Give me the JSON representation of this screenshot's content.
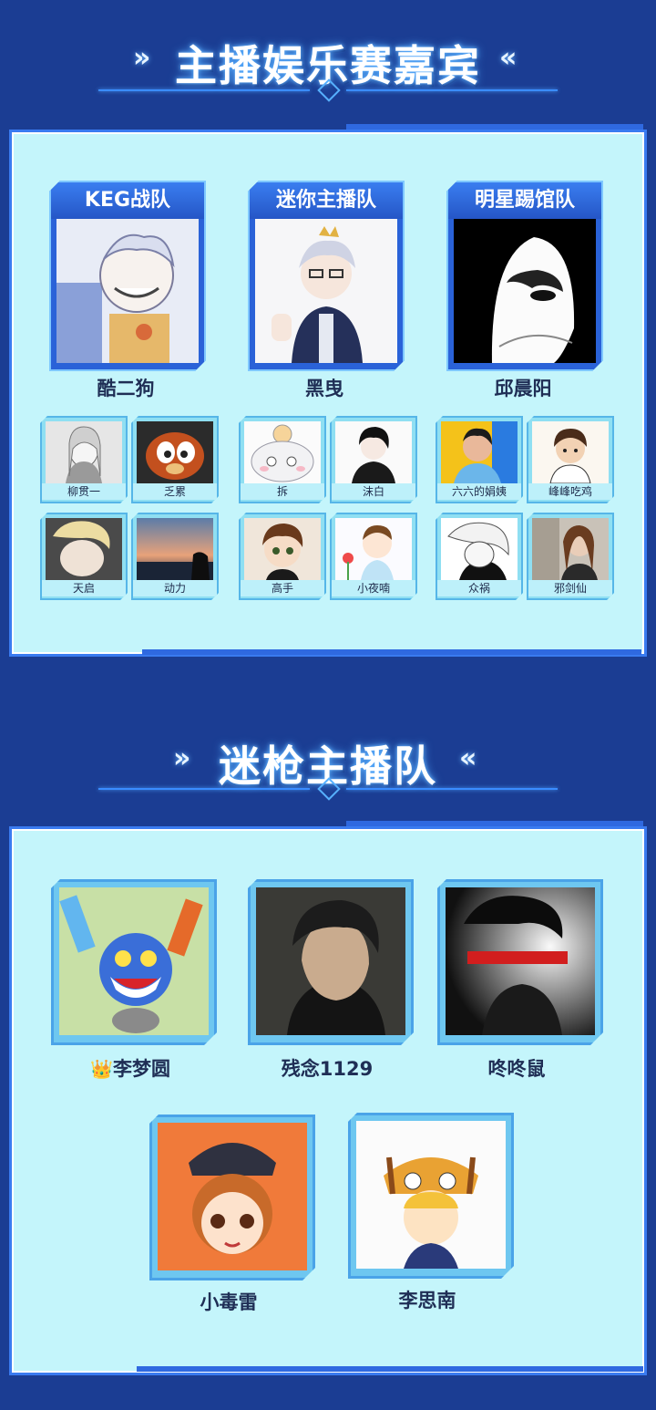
{
  "section1": {
    "title": "主播娱乐赛嘉宾",
    "chevron_left": "»",
    "chevron_right": "«",
    "teams": [
      {
        "name": "KEG战队",
        "captain": "酷二狗",
        "members": [
          "柳贯一",
          "乏累",
          "天启",
          "动力"
        ]
      },
      {
        "name": "迷你主播队",
        "captain": "黑曳",
        "members": [
          "拆",
          "沫白",
          "高手",
          "小夜喃"
        ]
      },
      {
        "name": "明星踢馆队",
        "captain": "邱晨阳",
        "members": [
          "六六的娟姨",
          "峰峰吃鸡",
          "众祸",
          "邪剑仙"
        ]
      }
    ]
  },
  "section2": {
    "title": "迷枪主播队",
    "chevron_left": "»",
    "chevron_right": "«",
    "crown_icon": "crown-icon",
    "members": [
      "李梦圆",
      "残念1129",
      "咚咚鼠",
      "小毒雷",
      "李思南"
    ]
  },
  "colors": {
    "background": "#1b3d93",
    "panel": "#c4f5fb",
    "accent": "#2a62d8",
    "text": "#1f2e55"
  }
}
